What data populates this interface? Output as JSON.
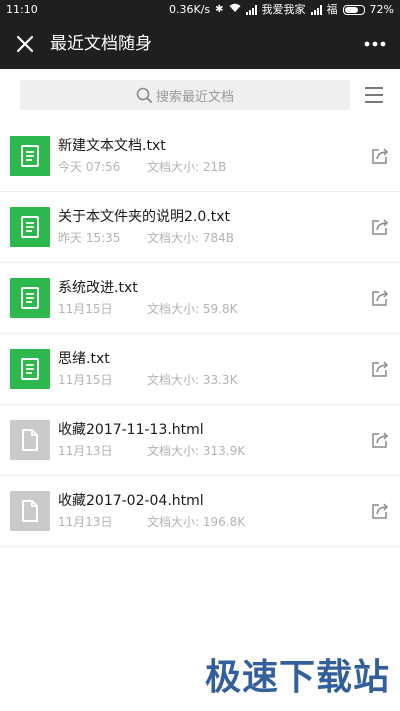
{
  "status_bar": {
    "time": "11:10",
    "network_speed": "0.36K/s",
    "carrier_1": "我爱我家",
    "carrier_2": "福",
    "battery": "72%"
  },
  "header": {
    "title": "最近文档随身"
  },
  "search": {
    "placeholder": "搜索最近文档"
  },
  "files": [
    {
      "name": "新建文本文档.txt",
      "date": "今天 07:56",
      "size": "文档大小: 21B",
      "type": "txt"
    },
    {
      "name": "关于本文件夹的说明2.0.txt",
      "date": "昨天 15:35",
      "size": "文档大小: 784B",
      "type": "txt"
    },
    {
      "name": "系统改进.txt",
      "date": "11月15日",
      "size": "文档大小: 59.8K",
      "type": "txt"
    },
    {
      "name": "思绪.txt",
      "date": "11月15日",
      "size": "文档大小: 33.3K",
      "type": "txt"
    },
    {
      "name": "收藏2017-11-13.html",
      "date": "11月13日",
      "size": "文档大小: 313.9K",
      "type": "html"
    },
    {
      "name": "收藏2017-02-04.html",
      "date": "11月13日",
      "size": "文档大小: 196.8K",
      "type": "html"
    }
  ],
  "watermark": {
    "text": "极速下载站"
  },
  "colors": {
    "header_bg": "#1f1f1f",
    "txt_icon": "#2db84d",
    "html_icon": "#cacaca",
    "watermark": "#1e4f93"
  }
}
